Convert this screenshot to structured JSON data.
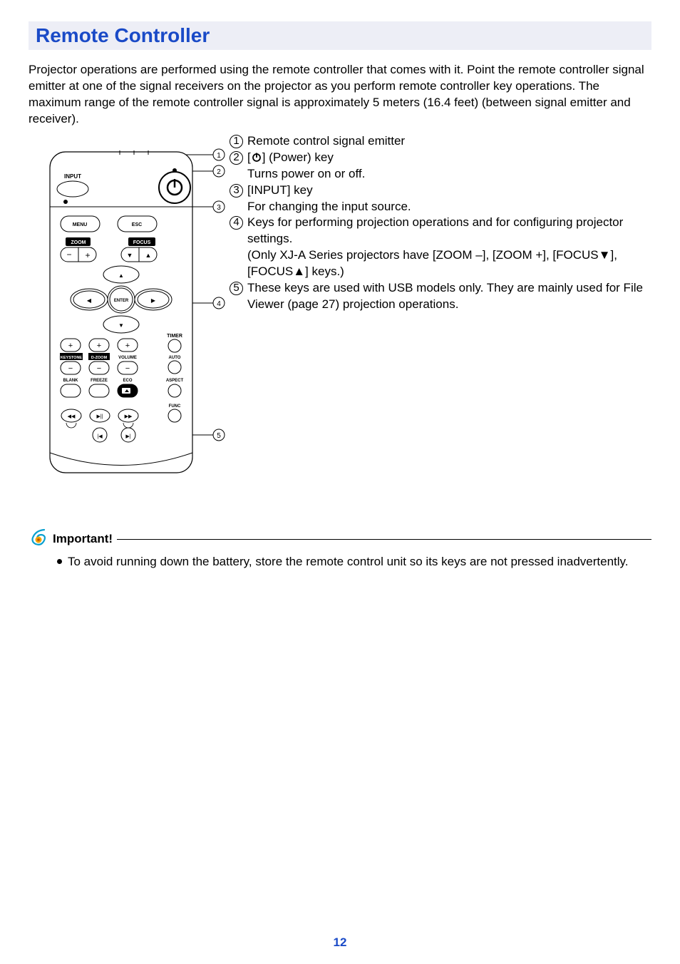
{
  "title": "Remote Controller",
  "intro": "Projector operations are performed using the remote controller that comes with it. Point the remote controller signal emitter at one of the signal receivers on the projector as you perform remote controller key operations. The maximum range of the remote controller signal is approximately 5 meters (16.4 feet) (between signal emitter and receiver).",
  "items": {
    "n1": "1",
    "t1": "Remote control signal emitter",
    "n2": "2",
    "t2a": "[",
    "t2b": "] (Power) key",
    "t2c": "Turns power on or off.",
    "n3": "3",
    "t3a": "[INPUT] key",
    "t3b": "For changing the input source.",
    "n4": "4",
    "t4a": "Keys for performing projection operations and for configuring projector settings.",
    "t4b": "(Only XJ-A Series projectors have [ZOOM –], [ZOOM +], [FOCUS▼], [FOCUS▲] keys.)",
    "n5": "5",
    "t5": "These keys are used with USB models only. They are mainly used for File Viewer (page 27) projection operations."
  },
  "important": {
    "label": "Important!",
    "text": "To avoid running down the battery, store the remote control unit so its keys are not pressed inadvertently."
  },
  "pageNumber": "12",
  "diagram": {
    "input": "INPUT",
    "menu": "MENU",
    "esc": "ESC",
    "zoom": "ZOOM",
    "focus": "FOCUS",
    "enter": "ENTER",
    "timer": "TIMER",
    "keystone": "KEYSTONE",
    "dzoom": "D-ZOOM",
    "volume": "VOLUME",
    "auto": "AUTO",
    "blank": "BLANK",
    "freeze": "FREEZE",
    "eco": "ECO",
    "aspect": "ASPECT",
    "func": "FUNC"
  }
}
